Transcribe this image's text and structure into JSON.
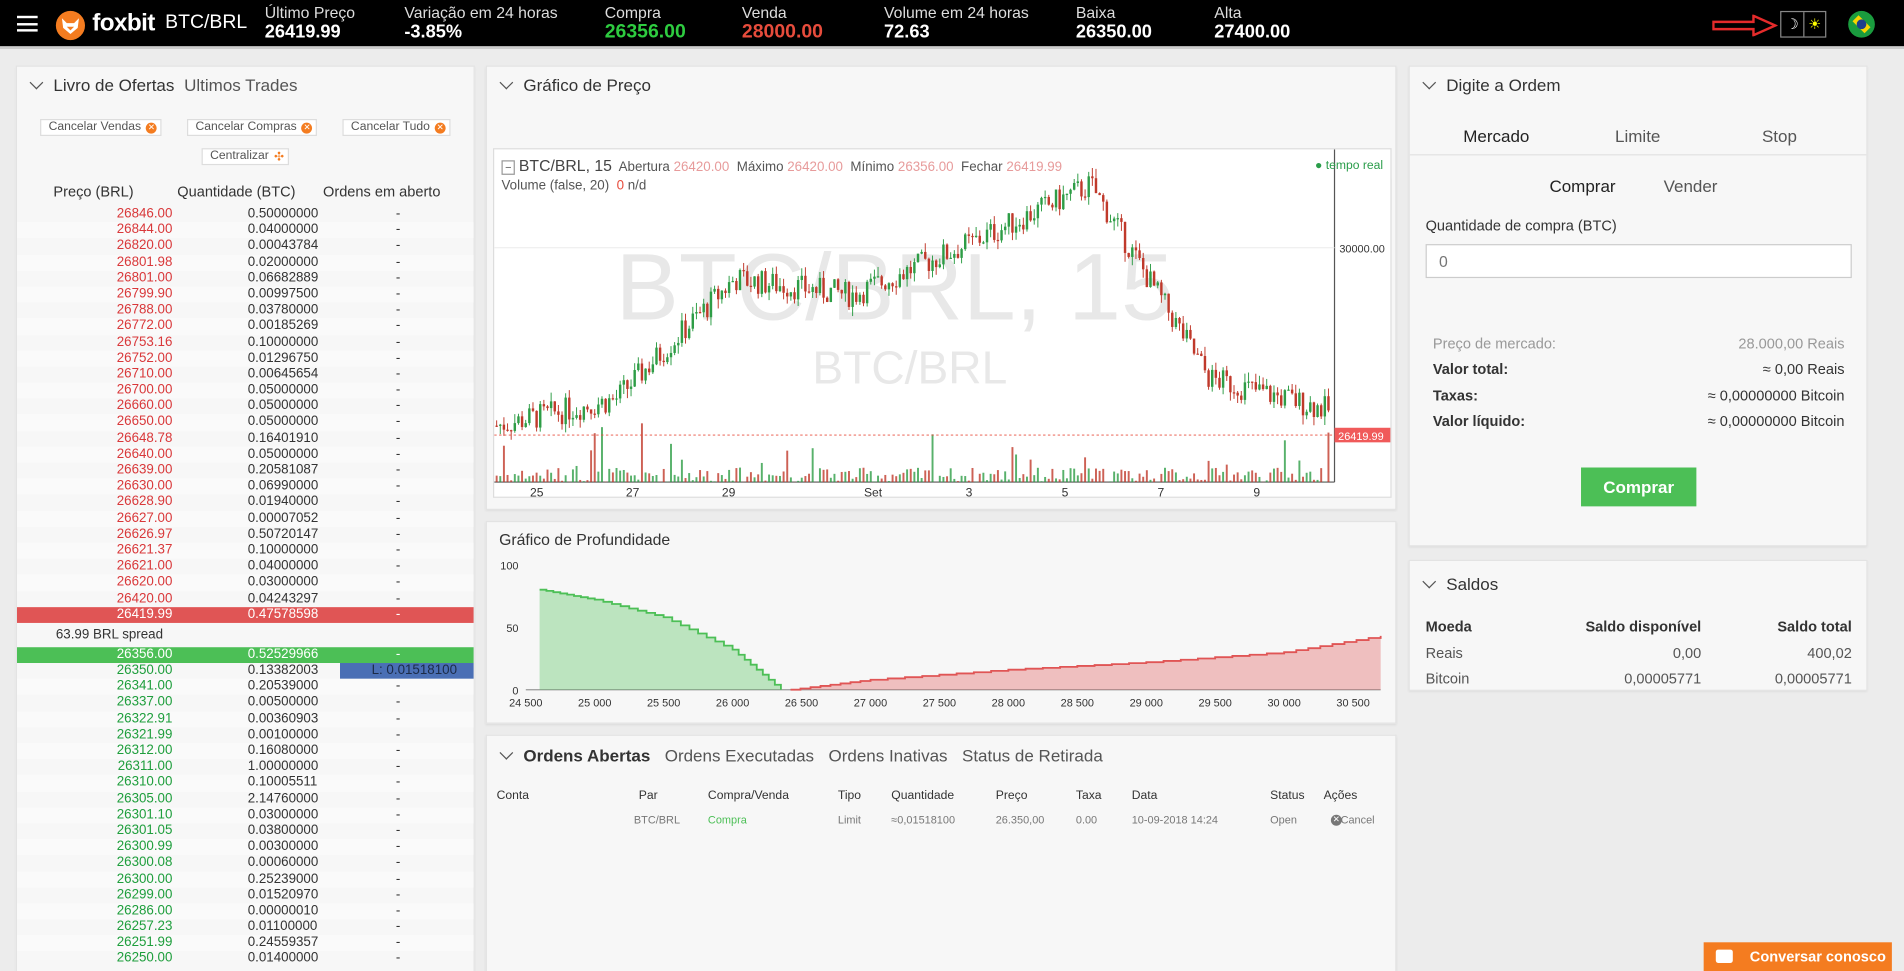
{
  "header": {
    "brand": "foxbit",
    "pair": "BTC/BRL",
    "stats": [
      {
        "label": "Último Preço",
        "value": "26419.99",
        "color": "white"
      },
      {
        "label": "Variação em 24 horas",
        "value": "-3.85%",
        "color": "white"
      },
      {
        "label": "Compra",
        "value": "26356.00",
        "color": "green"
      },
      {
        "label": "Venda",
        "value": "28000.00",
        "color": "red"
      },
      {
        "label": "Volume em 24 horas",
        "value": "72.63",
        "color": "white"
      },
      {
        "label": "Baixa",
        "value": "26350.00",
        "color": "white"
      },
      {
        "label": "Alta",
        "value": "27400.00",
        "color": "white"
      }
    ],
    "theme_dark": "☽",
    "theme_light": "☀"
  },
  "orderbook": {
    "tab_active": "Livro de Ofertas",
    "tab_other": "Ultimos Trades",
    "buttons": {
      "cancel_sells": "Cancelar Vendas",
      "cancel_buys": "Cancelar Compras",
      "cancel_all": "Cancelar Tudo",
      "center": "Centralizar"
    },
    "columns": [
      "Preço (BRL)",
      "Quantidade (BTC)",
      "Ordens em aberto"
    ],
    "asks": [
      [
        "26846.00",
        "0.50000000",
        "-"
      ],
      [
        "26844.00",
        "0.04000000",
        "-"
      ],
      [
        "26820.00",
        "0.00043784",
        "-"
      ],
      [
        "26801.98",
        "0.02000000",
        "-"
      ],
      [
        "26801.00",
        "0.06682889",
        "-"
      ],
      [
        "26799.90",
        "0.00997500",
        "-"
      ],
      [
        "26788.00",
        "0.03780000",
        "-"
      ],
      [
        "26772.00",
        "0.00185269",
        "-"
      ],
      [
        "26753.16",
        "0.10000000",
        "-"
      ],
      [
        "26752.00",
        "0.01296750",
        "-"
      ],
      [
        "26710.00",
        "0.00645654",
        "-"
      ],
      [
        "26700.00",
        "0.05000000",
        "-"
      ],
      [
        "26660.00",
        "0.05000000",
        "-"
      ],
      [
        "26650.00",
        "0.05000000",
        "-"
      ],
      [
        "26648.78",
        "0.16401910",
        "-"
      ],
      [
        "26640.00",
        "0.05000000",
        "-"
      ],
      [
        "26639.00",
        "0.20581087",
        "-"
      ],
      [
        "26630.00",
        "0.06990000",
        "-"
      ],
      [
        "26628.90",
        "0.01940000",
        "-"
      ],
      [
        "26627.00",
        "0.00007052",
        "-"
      ],
      [
        "26626.97",
        "0.50720147",
        "-"
      ],
      [
        "26621.37",
        "0.10000000",
        "-"
      ],
      [
        "26621.00",
        "0.04000000",
        "-"
      ],
      [
        "26620.00",
        "0.03000000",
        "-"
      ],
      [
        "26420.00",
        "0.04243297",
        "-"
      ]
    ],
    "best_ask": [
      "26419.99",
      "0.47578598",
      "-"
    ],
    "spread": "63.99 BRL spread",
    "best_bid": [
      "26356.00",
      "0.52529966",
      "-"
    ],
    "my_order_label": "L: 0.01518100",
    "bids": [
      [
        "26350.00",
        "0.13382003",
        ""
      ],
      [
        "26341.00",
        "0.20539000",
        "-"
      ],
      [
        "26337.00",
        "0.00500000",
        "-"
      ],
      [
        "26322.91",
        "0.00360903",
        "-"
      ],
      [
        "26321.99",
        "0.00100000",
        "-"
      ],
      [
        "26312.00",
        "0.16080000",
        "-"
      ],
      [
        "26311.00",
        "1.00000000",
        "-"
      ],
      [
        "26310.00",
        "0.10005511",
        "-"
      ],
      [
        "26305.00",
        "2.14760000",
        "-"
      ],
      [
        "26301.10",
        "0.03000000",
        "-"
      ],
      [
        "26301.05",
        "0.03800000",
        "-"
      ],
      [
        "26300.99",
        "0.00300000",
        "-"
      ],
      [
        "26300.08",
        "0.00060000",
        "-"
      ],
      [
        "26300.00",
        "0.25239000",
        "-"
      ],
      [
        "26299.00",
        "0.01520970",
        "-"
      ],
      [
        "26286.00",
        "0.00000010",
        "-"
      ],
      [
        "26257.23",
        "0.01100000",
        "-"
      ],
      [
        "26251.99",
        "0.24559357",
        "-"
      ],
      [
        "26250.00",
        "0.01400000",
        "-"
      ]
    ]
  },
  "price_chart": {
    "title": "Gráfico de Preço",
    "interval": "15",
    "legend": {
      "symbol": "BTC/BRL, 15",
      "open_label": "Abertura",
      "open": "26420.00",
      "high_label": "Máximo",
      "high": "26420.00",
      "low_label": "Mínimo",
      "low": "26356.00",
      "close_label": "Fechar",
      "close": "26419.99",
      "volume": "Volume (false, 20)",
      "volume_val": "0",
      "volume_na": "n/d"
    },
    "realtime": "tempo real",
    "watermark": "BTC/BRL, 15",
    "watermark2": "BTC/BRL",
    "y_label": "30000.00",
    "last_price": "26419.99",
    "x_labels": [
      "25",
      "27",
      "29",
      "Set",
      "3",
      "5",
      "7",
      "9"
    ]
  },
  "chart_data": [
    {
      "type": "line",
      "title": "Gráfico de Preço",
      "x": [
        "25",
        "27",
        "29",
        "Set",
        "3",
        "5",
        "7",
        "9"
      ],
      "series": [
        {
          "values": [
            26600,
            27100,
            29400,
            29100,
            30100,
            31200,
            27500,
            26900
          ]
        }
      ],
      "yticks": [
        "30000.00"
      ],
      "last": 26419.99
    },
    {
      "type": "area",
      "title": "Gráfico de Profundidade",
      "xticks": [
        "24 500",
        "25 000",
        "25 500",
        "26 000",
        "26 500",
        "27 000",
        "27 500",
        "28 000",
        "28 500",
        "29 000",
        "29 500",
        "30 000",
        "30 500"
      ],
      "yticks": [
        "100",
        "50",
        "0"
      ],
      "ylim": [
        0,
        100
      ],
      "series": [
        {
          "name": "bids",
          "x": [
            24600,
            25000,
            25500,
            26000,
            26350
          ],
          "values": [
            80,
            72,
            58,
            32,
            0
          ],
          "color": "#4cbf56"
        },
        {
          "name": "asks",
          "x": [
            26420,
            27000,
            28000,
            29000,
            30000,
            30700
          ],
          "values": [
            0,
            8,
            16,
            22,
            30,
            43
          ],
          "color": "#e05555"
        }
      ]
    }
  ],
  "depth_chart": {
    "title": "Gráfico de Profundidade"
  },
  "orders": {
    "tabs": [
      "Ordens Abertas",
      "Ordens Executadas",
      "Ordens Inativas",
      "Status de Retirada"
    ],
    "columns": [
      "Conta",
      "Par",
      "Compra/Venda",
      "Tipo",
      "Quantidade",
      "Preço",
      "Taxa",
      "Data",
      "Status",
      "Ações"
    ],
    "rows": [
      {
        "conta": "",
        "par": "BTC/BRL",
        "side": "Compra",
        "tipo": "Limit",
        "qtd": "≈0,01518100",
        "preco": "26.350,00",
        "taxa": "0.00",
        "data": "10-09-2018 14:24",
        "status": "Open",
        "acao": "Cancel"
      }
    ]
  },
  "order_form": {
    "title": "Digite a Ordem",
    "types": [
      "Mercado",
      "Limite",
      "Stop"
    ],
    "sides": [
      "Comprar",
      "Vender"
    ],
    "qty_label": "Quantidade de compra (BTC)",
    "qty_placeholder": "0",
    "market_price_label": "Preço de mercado:",
    "market_price": "28.000,00 Reais",
    "total_label": "Valor total:",
    "total": "≈ 0,00 Reais",
    "fees_label": "Taxas:",
    "fees": "≈ 0,00000000 Bitcoin",
    "net_label": "Valor líquido:",
    "net": "≈ 0,00000000 Bitcoin",
    "submit": "Comprar"
  },
  "balances": {
    "title": "Saldos",
    "columns": [
      "Moeda",
      "Saldo disponível",
      "Saldo total"
    ],
    "rows": [
      [
        "Reais",
        "0,00",
        "400,02"
      ],
      [
        "Bitcoin",
        "0,00005771",
        "0,00005771"
      ]
    ]
  },
  "chat": "Conversar conosco"
}
